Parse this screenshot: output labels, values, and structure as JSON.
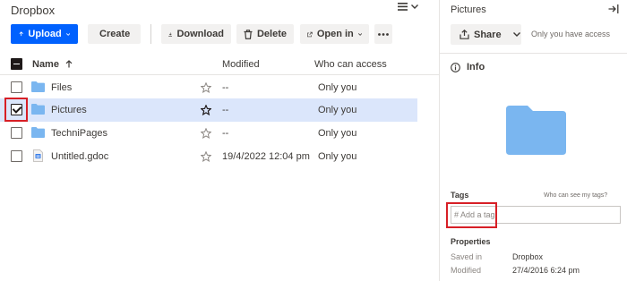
{
  "app": {
    "title": "Dropbox"
  },
  "toolbar": {
    "upload": "Upload",
    "create": "Create",
    "download": "Download",
    "delete": "Delete",
    "open_in": "Open in"
  },
  "columns": {
    "name": "Name",
    "modified": "Modified",
    "access": "Who can access"
  },
  "files": [
    {
      "name": "Files",
      "type": "folder",
      "modified": "--",
      "access": "Only you",
      "selected": false
    },
    {
      "name": "Pictures",
      "type": "folder",
      "modified": "--",
      "access": "Only you",
      "selected": true
    },
    {
      "name": "TechniPages",
      "type": "folder",
      "modified": "--",
      "access": "Only you",
      "selected": false
    },
    {
      "name": "Untitled.gdoc",
      "type": "gdoc",
      "modified": "19/4/2022 12:04 pm",
      "access": "Only you",
      "selected": false
    }
  ],
  "panel": {
    "title": "Pictures",
    "share": "Share",
    "access_note": "Only you have access",
    "info_label": "Info",
    "tags_label": "Tags",
    "tags_link": "Who can see my tags?",
    "tag_placeholder": "# Add a tag",
    "properties_label": "Properties",
    "properties": [
      {
        "key": "Saved in",
        "value": "Dropbox"
      },
      {
        "key": "Modified",
        "value": "27/4/2016 6:24 pm"
      }
    ]
  },
  "colors": {
    "accent": "#0061fe",
    "folder": "#7ab6f0",
    "selected_row": "#dbe6fb",
    "highlight": "#d71f26"
  }
}
